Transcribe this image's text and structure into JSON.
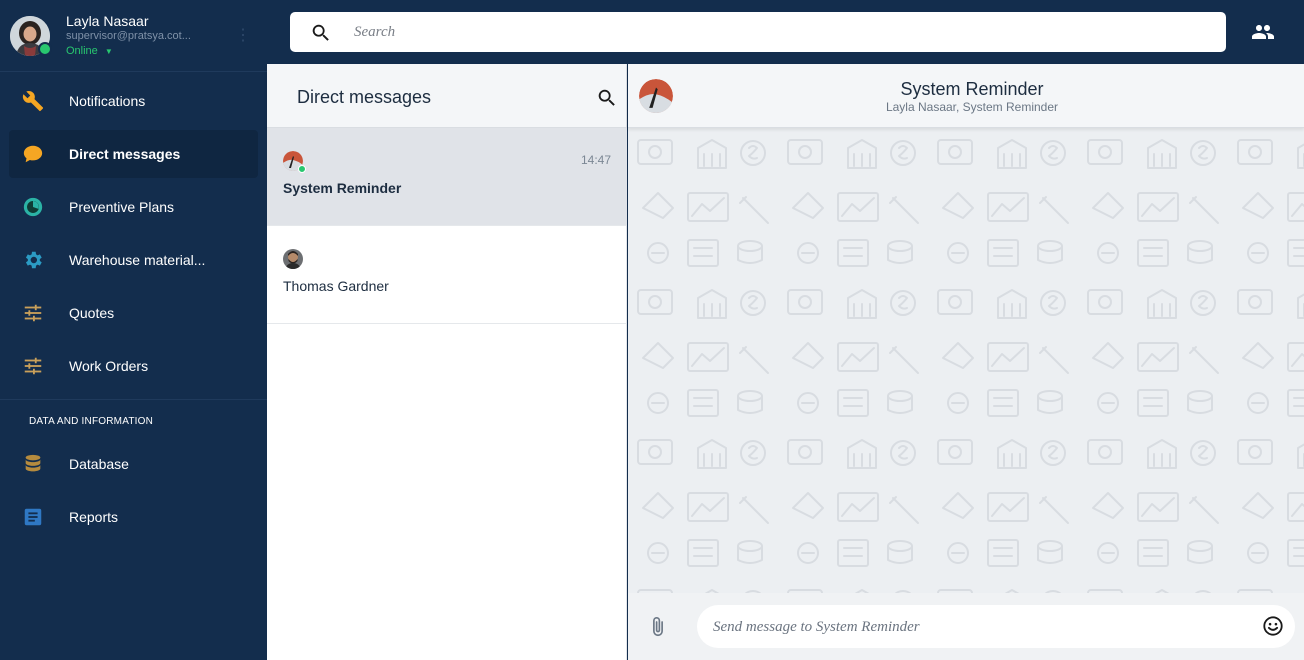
{
  "user": {
    "name": "Layla Nasaar",
    "email": "supervisor@pratsya.cot...",
    "status": "Online"
  },
  "nav": {
    "items": [
      {
        "label": "Notifications",
        "icon": "wrench-icon"
      },
      {
        "label": "Direct messages",
        "icon": "chat-bubble-icon",
        "active": true
      },
      {
        "label": "Preventive Plans",
        "icon": "gauge-icon"
      },
      {
        "label": "Warehouse material...",
        "icon": "gear-icon"
      },
      {
        "label": "Quotes",
        "icon": "sliders-icon"
      },
      {
        "label": "Work Orders",
        "icon": "sliders-icon"
      }
    ],
    "section_title": "DATA AND INFORMATION",
    "section_items": [
      {
        "label": "Database",
        "icon": "database-icon"
      },
      {
        "label": "Reports",
        "icon": "document-icon"
      }
    ]
  },
  "search": {
    "placeholder": "Search",
    "value": ""
  },
  "dm_panel": {
    "title": "Direct messages",
    "conversations": [
      {
        "name": "System Reminder",
        "time": "14:47",
        "online": true,
        "selected": true
      },
      {
        "name": "Thomas Gardner",
        "time": "",
        "online": false,
        "selected": false
      }
    ]
  },
  "chat": {
    "title": "System Reminder",
    "participants": "Layla Nasaar, System Reminder",
    "composer_placeholder": "Send message to System Reminder"
  },
  "colors": {
    "sidebar_bg": "#132d4d",
    "active_item_bg": "#0f2641",
    "online_green": "#28c76f",
    "accent_orange": "#f5a623",
    "accent_teal": "#2bb3a6",
    "chat_bg": "#eceff2"
  }
}
